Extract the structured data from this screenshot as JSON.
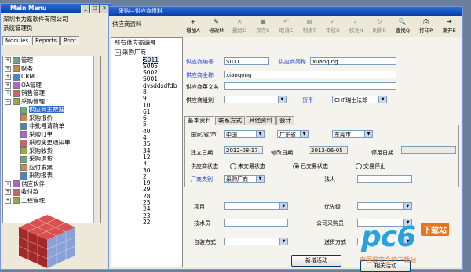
{
  "main_menu": {
    "title": "Main Menu",
    "company": "深圳市力嘉软件有限公司",
    "user": "系统管理员",
    "tabs": [
      "Modules",
      "Reports",
      "Print"
    ],
    "tree": [
      {
        "label": "管理",
        "level": 0
      },
      {
        "label": "财务",
        "level": 0
      },
      {
        "label": "CRM",
        "level": 0
      },
      {
        "label": "OA管理",
        "level": 0
      },
      {
        "label": "销售管理",
        "level": 0
      },
      {
        "label": "采购管理",
        "level": 0
      },
      {
        "label": "供应商主数据",
        "level": 1,
        "selected": true
      },
      {
        "label": "采购报价",
        "level": 1
      },
      {
        "label": "非批号请购单",
        "level": 1
      },
      {
        "label": "采购订单",
        "level": 1
      },
      {
        "label": "采购变更通知单",
        "level": 1
      },
      {
        "label": "采购收货",
        "level": 1
      },
      {
        "label": "采购退货",
        "level": 1
      },
      {
        "label": "应付发票",
        "level": 1
      },
      {
        "label": "采购报表",
        "level": 1
      },
      {
        "label": "供应伙伴",
        "level": 0
      },
      {
        "label": "收付款",
        "level": 0
      },
      {
        "label": "工程管理",
        "level": 0
      }
    ]
  },
  "supplier_window": {
    "title": "采购—供应商资料",
    "header": "供应商资料",
    "toolbar": [
      {
        "label": "增加A",
        "icon": "+",
        "enabled": true
      },
      {
        "label": "修改M",
        "icon": "✎",
        "enabled": true
      },
      {
        "label": "删除D",
        "icon": "✕",
        "enabled": false
      },
      {
        "label": "保存S",
        "icon": "■",
        "enabled": false
      },
      {
        "label": "取消C",
        "icon": "↶",
        "enabled": false
      },
      {
        "label": "制表T",
        "icon": "▤",
        "enabled": false
      },
      {
        "label": "审核U",
        "icon": "✓",
        "enabled": false
      },
      {
        "label": "核准N",
        "icon": "✓",
        "enabled": false
      },
      {
        "label": "刷新R",
        "icon": "↻",
        "enabled": false
      },
      {
        "label": "查找Q",
        "icon": "🔍",
        "enabled": true
      },
      {
        "label": "打印P",
        "icon": "⎙",
        "enabled": true
      },
      {
        "label": "离开E",
        "icon": "⇥",
        "enabled": true
      }
    ],
    "list_header": "所有供应商编号",
    "list_group": "采购厂商",
    "list": [
      "S011",
      "S005",
      "S002",
      "S001",
      "dvsddsdfdb",
      "8",
      "9",
      "10",
      "61",
      "6",
      "5",
      "40",
      "4",
      "35",
      "34",
      "12",
      "3",
      "30",
      "2",
      "19",
      "29",
      "28",
      "25",
      "24",
      "23",
      "22"
    ],
    "form": {
      "supplier_no_label": "供应商编号",
      "supplier_no": "S011",
      "short_name_label": "供应商简称",
      "short_name": "xuanqing",
      "full_name_label": "供应商全称",
      "full_name": "xianqong",
      "english_name_label": "供应商英文名",
      "english_name": "",
      "group_label": "供应商组别",
      "group": "",
      "currency_label": "货币",
      "currency": "CHF瑞士法郎"
    },
    "subtabs": [
      "基本资料",
      "联系方式",
      "其他资料",
      "会计"
    ],
    "basic": {
      "region_label": "国家/省/市",
      "country": "中国",
      "province": "广东省",
      "city": "东莞市",
      "created_label": "建立日期",
      "created": "2012-08-17",
      "modified_label": "修改日期",
      "modified": "2013-06-05",
      "stopped_label": "停用日期",
      "status_label": "供应商状态",
      "status_options": [
        "未交易状态",
        "已交易状态",
        "交易停止"
      ],
      "status_selected": 1,
      "category_label": "厂商类别",
      "category": "采购厂商",
      "legal_label": "法人",
      "item_label": "项目",
      "priority_label": "优先级",
      "tech_label": "技术员",
      "buyer_label": "公司采购员",
      "package_label": "包装方式",
      "delivery_label": "送货方式"
    },
    "buttons": {
      "new_activity": "新增活动",
      "related_activity": "相关活动"
    }
  },
  "logo": {
    "brand": "pc6",
    "badge": "下载站",
    "tagline": "中国最安全的下载站"
  }
}
